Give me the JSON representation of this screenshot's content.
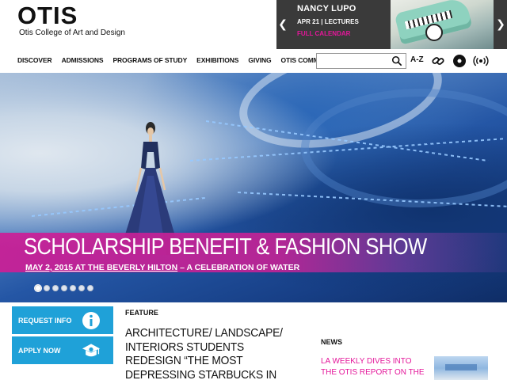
{
  "header": {
    "logo": "OTIS",
    "tagline": "Otis College of Art and Design"
  },
  "event": {
    "name": "NANCY LUPO",
    "date": "APR 21 | LECTURES",
    "calendar_link": "FULL CALENDAR",
    "prev_icon": "chevron-left-icon",
    "next_icon": "chevron-right-icon"
  },
  "nav": {
    "items": [
      "DISCOVER",
      "ADMISSIONS",
      "PROGRAMS OF STUDY",
      "EXHIBITIONS",
      "GIVING",
      "OTIS COMMUNITY"
    ]
  },
  "toolbar": {
    "search_value": "",
    "search_icon": "search-icon",
    "az_label": "A-Z",
    "link_icon": "link-icon",
    "record_icon": "record-icon",
    "broadcast_icon": "broadcast-icon"
  },
  "hero": {
    "title": "SCHOLARSHIP BENEFIT & FASHION SHOW",
    "subtitle_link": "MAY 2, 2015 AT THE BEVERLY HILTON",
    "subtitle_rest": " – A CELEBRATION OF WATER",
    "slide_count": 7,
    "active_slide": 1
  },
  "cta": {
    "request_info": "REQUEST INFO",
    "request_icon": "info-icon",
    "apply_now": "APPLY NOW",
    "apply_icon": "school-icon"
  },
  "feature": {
    "label": "FEATURE",
    "headline": "ARCHITECTURE/ LANDSCAPE/ INTERIORS STUDENTS REDESIGN “THE MOST DEPRESSING STARBUCKS IN AMERICA” FOR THE"
  },
  "news": {
    "label": "NEWS",
    "headline": "LA WEEKLY DIVES INTO THE OTIS REPORT ON THE"
  },
  "colors": {
    "accent_magenta": "#e4169a",
    "cta_blue": "#1fa1d8",
    "event_bg": "#3a3a3a"
  }
}
